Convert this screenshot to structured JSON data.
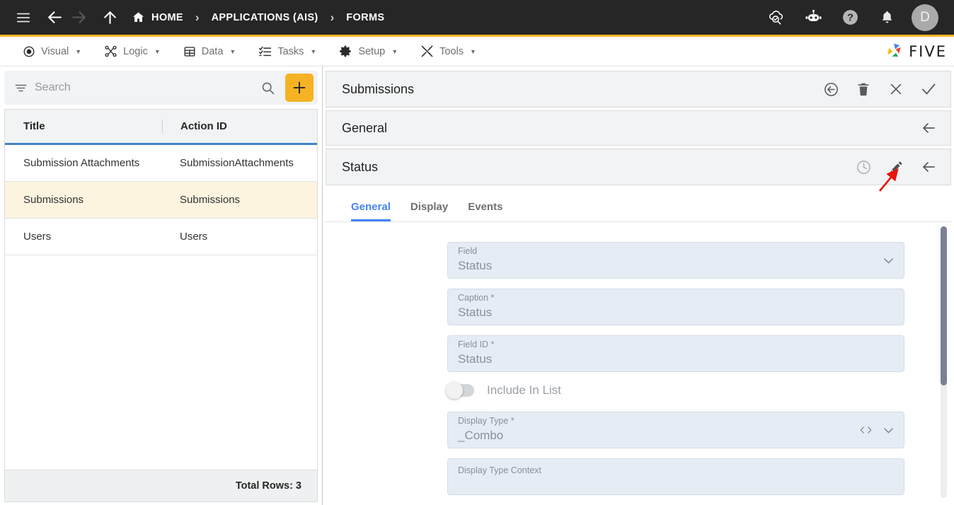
{
  "topbar": {
    "icons": [
      "hamburger-menu",
      "back-arrow",
      "forward-arrow",
      "up-arrow"
    ],
    "breadcrumbs": [
      {
        "label": "HOME",
        "icon": "home-icon"
      },
      {
        "label": "APPLICATIONS (AIS)",
        "icon": ""
      },
      {
        "label": "FORMS",
        "icon": ""
      }
    ],
    "separator": "›",
    "right_icons": [
      "cloud-search-icon",
      "robot-icon",
      "help-icon",
      "bell-icon"
    ],
    "avatar_initial": "D",
    "accent_color": "#F5B324",
    "background_color": "#262626"
  },
  "menubar": {
    "items": [
      {
        "label": "Visual",
        "icon": "eye-icon"
      },
      {
        "label": "Logic",
        "icon": "logic-nodes-icon"
      },
      {
        "label": "Data",
        "icon": "table-icon"
      },
      {
        "label": "Tasks",
        "icon": "checklist-icon"
      },
      {
        "label": "Setup",
        "icon": "gear-icon"
      },
      {
        "label": "Tools",
        "icon": "tools-icon"
      }
    ],
    "caret": "▼",
    "brand": "FIVE"
  },
  "left_panel": {
    "search": {
      "placeholder": "Search",
      "value": ""
    },
    "filter_icon": "filter-icon",
    "search_icon": "search-icon",
    "add_label": "+",
    "columns": [
      "Title",
      "Action ID"
    ],
    "rows": [
      {
        "title": "Submission Attachments",
        "action_id": "SubmissionAttachments",
        "selected": false
      },
      {
        "title": "Submissions",
        "action_id": "Submissions",
        "selected": true
      },
      {
        "title": "Users",
        "action_id": "Users",
        "selected": false
      }
    ],
    "total_rows": "Total Rows: 3"
  },
  "right_panel": {
    "record_bar": {
      "title": "Submissions",
      "actions": [
        "undo-back-icon",
        "delete-icon",
        "close-icon",
        "confirm-icon"
      ]
    },
    "general_bar": {
      "title": "General",
      "actions": [
        "collapse-left-arrow-icon"
      ]
    },
    "status_bar": {
      "title": "Status",
      "actions": [
        "history-clock-icon",
        "edit-pencil-icon",
        "collapse-left-arrow-icon"
      ]
    },
    "tabs": [
      {
        "label": "General",
        "active": true
      },
      {
        "label": "Display",
        "active": false
      },
      {
        "label": "Events",
        "active": false
      }
    ],
    "fields": [
      {
        "label": "Field",
        "value": "Status",
        "trailing": [
          "chevron-down-icon"
        ],
        "type": "select"
      },
      {
        "label": "Caption *",
        "value": "Status",
        "trailing": [],
        "type": "text"
      },
      {
        "label": "Field ID *",
        "value": "Status",
        "trailing": [],
        "type": "text"
      },
      {
        "label": "Display Type *",
        "value": "_Combo",
        "trailing": [
          "code-brackets-icon",
          "chevron-down-icon"
        ],
        "type": "select"
      },
      {
        "label": "Display Type Context",
        "value": "",
        "trailing": [],
        "type": "textarea"
      }
    ],
    "toggle": {
      "label": "Include In List",
      "on": false
    }
  },
  "annotation": {
    "type": "red-arrow",
    "points_to": "edit-pencil-icon",
    "color": "#e8120b"
  },
  "colors": {
    "accent_amber": "#F5B324",
    "tab_blue": "#4285F4",
    "row_selected": "#fdf4e0",
    "field_bg": "#e5ecf4",
    "panel_bg": "#f1f3f4"
  }
}
